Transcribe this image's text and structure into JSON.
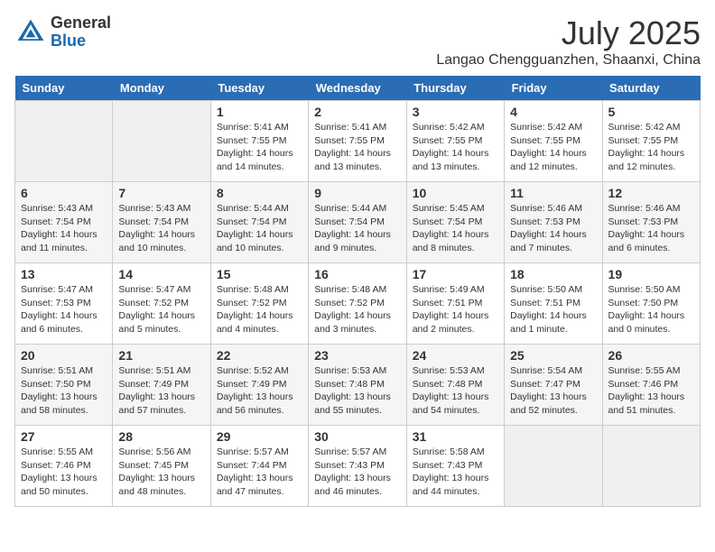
{
  "header": {
    "logo_general": "General",
    "logo_blue": "Blue",
    "month": "July 2025",
    "location": "Langao Chengguanzhen, Shaanxi, China"
  },
  "weekdays": [
    "Sunday",
    "Monday",
    "Tuesday",
    "Wednesday",
    "Thursday",
    "Friday",
    "Saturday"
  ],
  "weeks": [
    [
      {
        "day": "",
        "info": ""
      },
      {
        "day": "",
        "info": ""
      },
      {
        "day": "1",
        "info": "Sunrise: 5:41 AM\nSunset: 7:55 PM\nDaylight: 14 hours and 14 minutes."
      },
      {
        "day": "2",
        "info": "Sunrise: 5:41 AM\nSunset: 7:55 PM\nDaylight: 14 hours and 13 minutes."
      },
      {
        "day": "3",
        "info": "Sunrise: 5:42 AM\nSunset: 7:55 PM\nDaylight: 14 hours and 13 minutes."
      },
      {
        "day": "4",
        "info": "Sunrise: 5:42 AM\nSunset: 7:55 PM\nDaylight: 14 hours and 12 minutes."
      },
      {
        "day": "5",
        "info": "Sunrise: 5:42 AM\nSunset: 7:55 PM\nDaylight: 14 hours and 12 minutes."
      }
    ],
    [
      {
        "day": "6",
        "info": "Sunrise: 5:43 AM\nSunset: 7:54 PM\nDaylight: 14 hours and 11 minutes."
      },
      {
        "day": "7",
        "info": "Sunrise: 5:43 AM\nSunset: 7:54 PM\nDaylight: 14 hours and 10 minutes."
      },
      {
        "day": "8",
        "info": "Sunrise: 5:44 AM\nSunset: 7:54 PM\nDaylight: 14 hours and 10 minutes."
      },
      {
        "day": "9",
        "info": "Sunrise: 5:44 AM\nSunset: 7:54 PM\nDaylight: 14 hours and 9 minutes."
      },
      {
        "day": "10",
        "info": "Sunrise: 5:45 AM\nSunset: 7:54 PM\nDaylight: 14 hours and 8 minutes."
      },
      {
        "day": "11",
        "info": "Sunrise: 5:46 AM\nSunset: 7:53 PM\nDaylight: 14 hours and 7 minutes."
      },
      {
        "day": "12",
        "info": "Sunrise: 5:46 AM\nSunset: 7:53 PM\nDaylight: 14 hours and 6 minutes."
      }
    ],
    [
      {
        "day": "13",
        "info": "Sunrise: 5:47 AM\nSunset: 7:53 PM\nDaylight: 14 hours and 6 minutes."
      },
      {
        "day": "14",
        "info": "Sunrise: 5:47 AM\nSunset: 7:52 PM\nDaylight: 14 hours and 5 minutes."
      },
      {
        "day": "15",
        "info": "Sunrise: 5:48 AM\nSunset: 7:52 PM\nDaylight: 14 hours and 4 minutes."
      },
      {
        "day": "16",
        "info": "Sunrise: 5:48 AM\nSunset: 7:52 PM\nDaylight: 14 hours and 3 minutes."
      },
      {
        "day": "17",
        "info": "Sunrise: 5:49 AM\nSunset: 7:51 PM\nDaylight: 14 hours and 2 minutes."
      },
      {
        "day": "18",
        "info": "Sunrise: 5:50 AM\nSunset: 7:51 PM\nDaylight: 14 hours and 1 minute."
      },
      {
        "day": "19",
        "info": "Sunrise: 5:50 AM\nSunset: 7:50 PM\nDaylight: 14 hours and 0 minutes."
      }
    ],
    [
      {
        "day": "20",
        "info": "Sunrise: 5:51 AM\nSunset: 7:50 PM\nDaylight: 13 hours and 58 minutes."
      },
      {
        "day": "21",
        "info": "Sunrise: 5:51 AM\nSunset: 7:49 PM\nDaylight: 13 hours and 57 minutes."
      },
      {
        "day": "22",
        "info": "Sunrise: 5:52 AM\nSunset: 7:49 PM\nDaylight: 13 hours and 56 minutes."
      },
      {
        "day": "23",
        "info": "Sunrise: 5:53 AM\nSunset: 7:48 PM\nDaylight: 13 hours and 55 minutes."
      },
      {
        "day": "24",
        "info": "Sunrise: 5:53 AM\nSunset: 7:48 PM\nDaylight: 13 hours and 54 minutes."
      },
      {
        "day": "25",
        "info": "Sunrise: 5:54 AM\nSunset: 7:47 PM\nDaylight: 13 hours and 52 minutes."
      },
      {
        "day": "26",
        "info": "Sunrise: 5:55 AM\nSunset: 7:46 PM\nDaylight: 13 hours and 51 minutes."
      }
    ],
    [
      {
        "day": "27",
        "info": "Sunrise: 5:55 AM\nSunset: 7:46 PM\nDaylight: 13 hours and 50 minutes."
      },
      {
        "day": "28",
        "info": "Sunrise: 5:56 AM\nSunset: 7:45 PM\nDaylight: 13 hours and 48 minutes."
      },
      {
        "day": "29",
        "info": "Sunrise: 5:57 AM\nSunset: 7:44 PM\nDaylight: 13 hours and 47 minutes."
      },
      {
        "day": "30",
        "info": "Sunrise: 5:57 AM\nSunset: 7:43 PM\nDaylight: 13 hours and 46 minutes."
      },
      {
        "day": "31",
        "info": "Sunrise: 5:58 AM\nSunset: 7:43 PM\nDaylight: 13 hours and 44 minutes."
      },
      {
        "day": "",
        "info": ""
      },
      {
        "day": "",
        "info": ""
      }
    ]
  ]
}
